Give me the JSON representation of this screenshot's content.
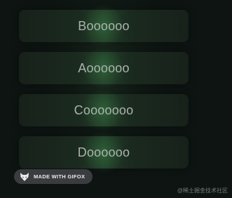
{
  "items": [
    {
      "label": "Boooooo"
    },
    {
      "label": "Aoooooo"
    },
    {
      "label": "Cooooooo"
    },
    {
      "label": "Doooooo"
    }
  ],
  "badge": {
    "text": "MADE WITH GIFOX",
    "icon": "gifox-fox-icon"
  },
  "watermark": {
    "text": "@稀土掘金技术社区"
  },
  "colors": {
    "background": "#111a15",
    "item_background": "#1b2a1f",
    "item_glow": "#46964f",
    "item_text": "#aab4ad",
    "badge_background": "#3a3c3f",
    "badge_text": "#e9eaeb"
  }
}
